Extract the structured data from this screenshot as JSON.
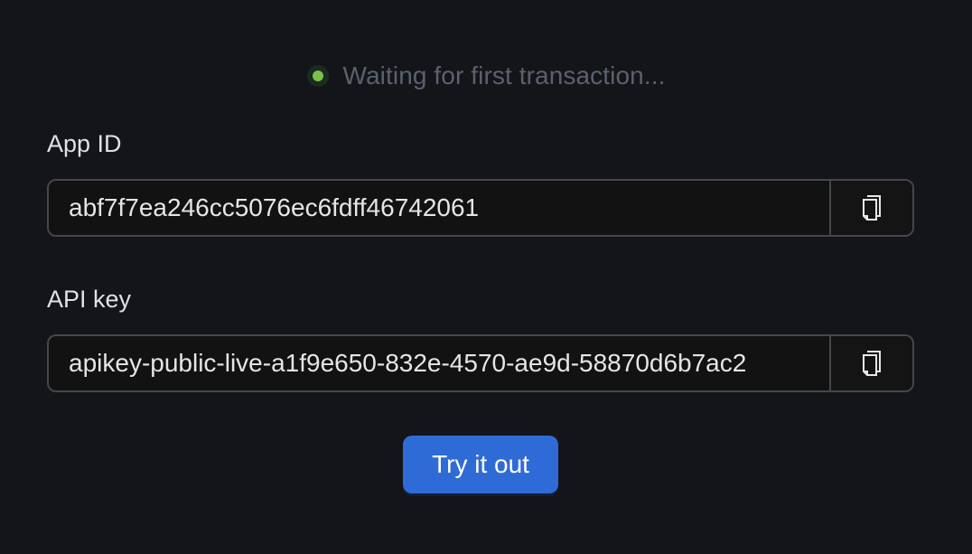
{
  "status": {
    "text": "Waiting for first transaction...",
    "dot_color": "#7cc04a"
  },
  "app_id": {
    "label": "App ID",
    "value": "abf7f7ea246cc5076ec6fdff46742061",
    "copy_icon": "copy-icon"
  },
  "api_key": {
    "label": "API key",
    "value": "apikey-public-live-a1f9e650-832e-4570-ae9d-58870d6b7ac2",
    "copy_icon": "copy-icon"
  },
  "try_button": {
    "label": "Try it out",
    "color": "#2f6bd7"
  }
}
